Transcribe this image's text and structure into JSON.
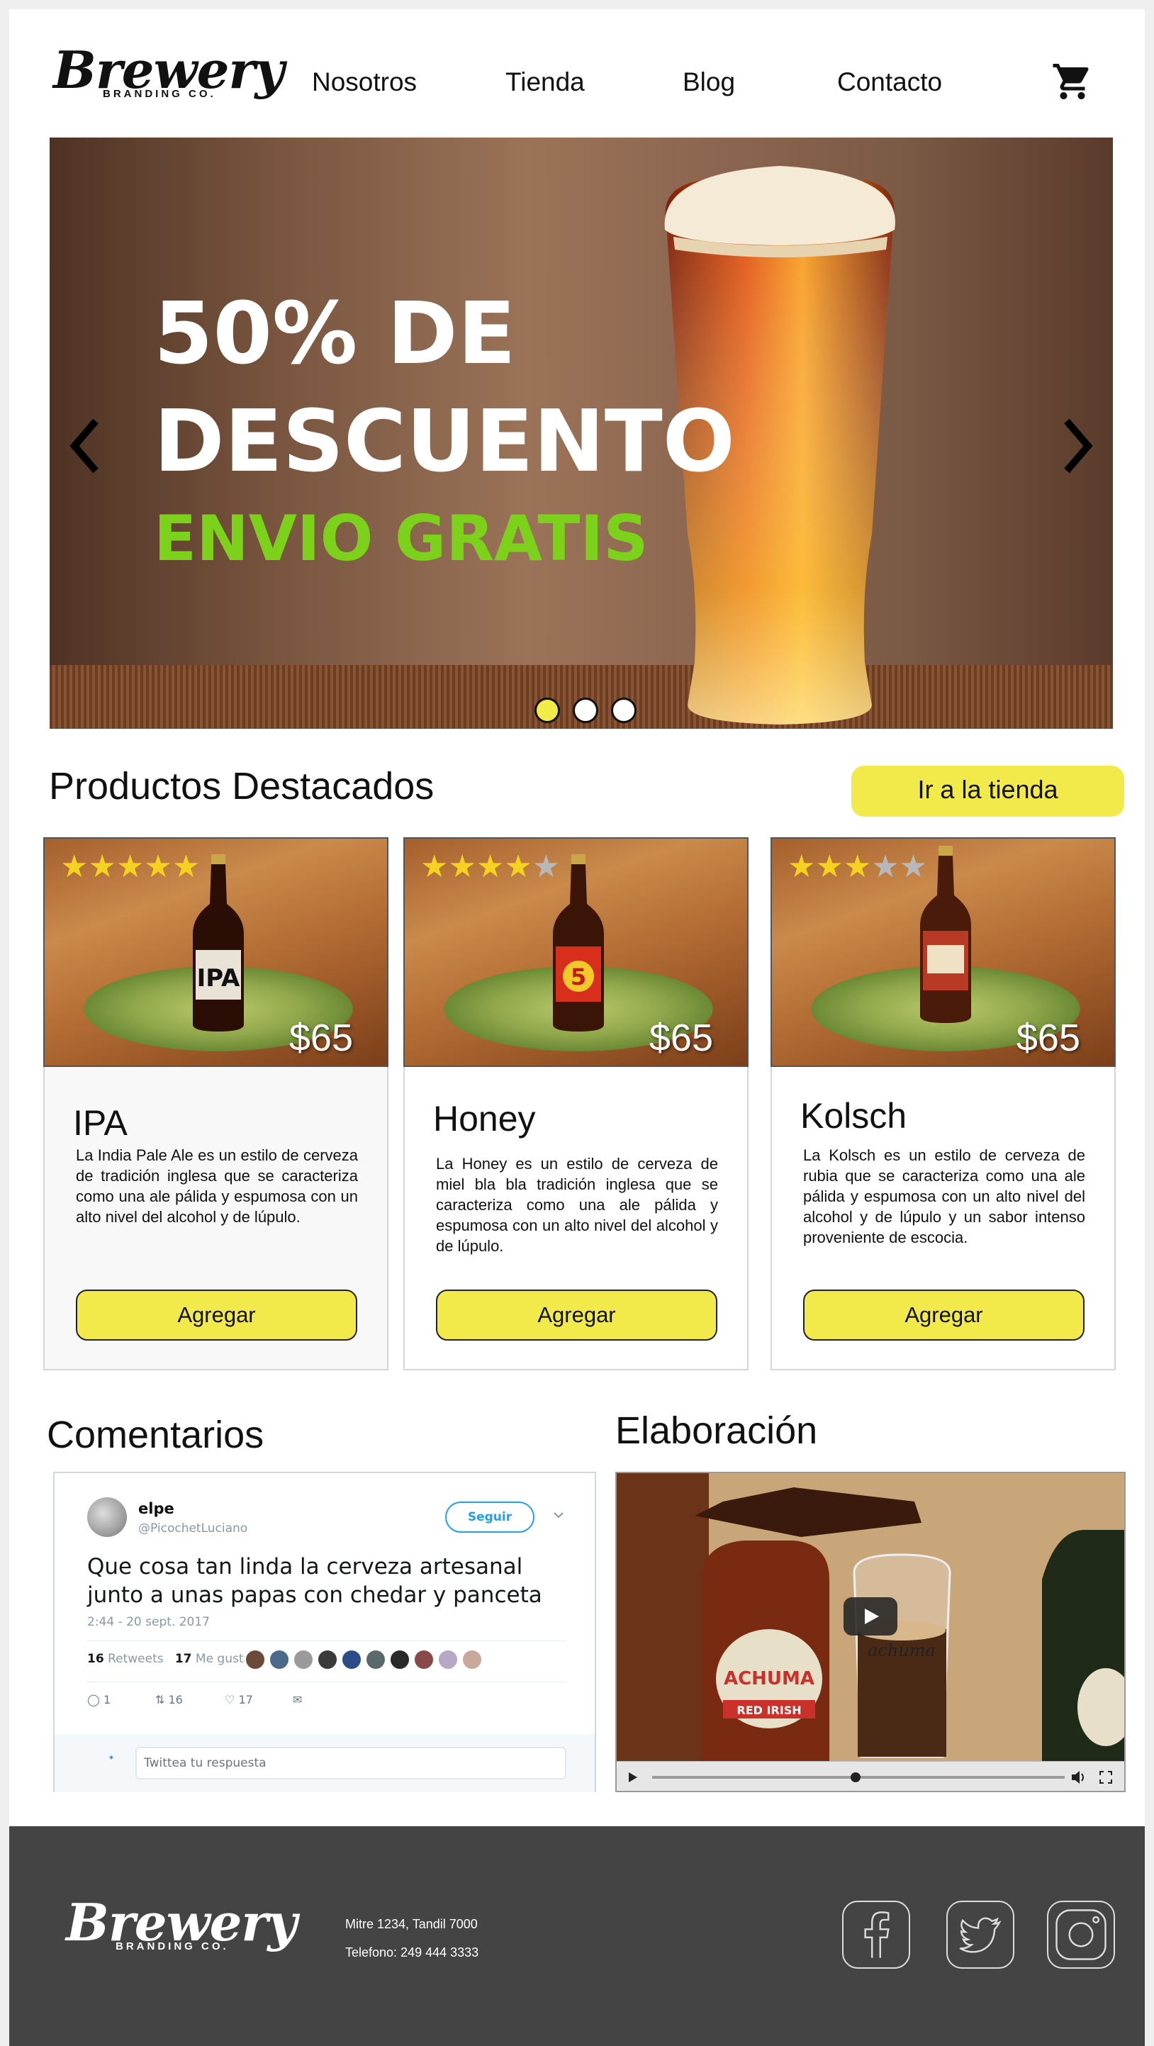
{
  "header": {
    "logo_main": "Brewery",
    "logo_sub": "BRANDING CO.",
    "nav": [
      "Nosotros",
      "Tienda",
      "Blog",
      "Contacto"
    ],
    "cart_icon": "shopping-cart-icon"
  },
  "hero": {
    "line1": "50% DE",
    "line2": "DESCUENTO",
    "line3": "ENVIO GRATIS",
    "accent_color": "#7cd11a",
    "slides": 3,
    "active_slide": 1
  },
  "products": {
    "title": "Productos Destacados",
    "shop_button": "Ir a la tienda",
    "button_color": "#f2ea4b",
    "items": [
      {
        "name": "IPA",
        "price": "$65",
        "rating": 5,
        "description": "La India Pale Ale es un estilo de cerveza de tradición inglesa que se caracteriza como una ale pálida y espumosa con un alto nivel del alcohol y de lúpulo.",
        "add_label": "Agregar",
        "bottle_label": "IPA"
      },
      {
        "name": "Honey",
        "price": "$65",
        "rating": 4,
        "description": "La Honey es un estilo de cerveza de miel bla bla tradición inglesa que se caracteriza como una ale pálida y espumosa con un alto nivel del alcohol y de lúpulo.",
        "add_label": "Agregar",
        "bottle_label": "5"
      },
      {
        "name": "Kolsch",
        "price": "$65",
        "rating": 3,
        "description": "La Kolsch  es un estilo de cerveza de rubia que se caracteriza como una ale pálida y espumosa con un alto nivel del alcohol y de lúpulo y un sabor intenso proveniente de escocia.",
        "add_label": "Agregar",
        "bottle_label": ""
      }
    ]
  },
  "comments": {
    "title": "Comentarios",
    "tweet": {
      "user": "elpe",
      "handle": "@PicochetLuciano",
      "follow": "Seguir",
      "text": "Que cosa tan linda la cerveza artesanal junto a unas papas con chedar y panceta",
      "date": "2:44 - 20 sept. 2017",
      "retweets_count": "16",
      "retweets_label": "Retweets",
      "likes_count": "17",
      "likes_label": "Me gusta",
      "reply_count": "1",
      "rt_count": "16",
      "fav_count": "17",
      "reply_placeholder": "Twittea tu respuesta"
    }
  },
  "elaboracion": {
    "title": "Elaboración",
    "video_brand": "achuma",
    "video_label": "ACHUMA",
    "video_sublabel": "RED IRISH"
  },
  "footer": {
    "logo_main": "Brewery",
    "logo_sub": "BRANDING CO.",
    "address": "Mitre 1234, Tandil 7000",
    "phone": "Telefono: 249 444 3333",
    "social": [
      "facebook-icon",
      "twitter-icon",
      "instagram-icon"
    ],
    "background": "#444444"
  }
}
